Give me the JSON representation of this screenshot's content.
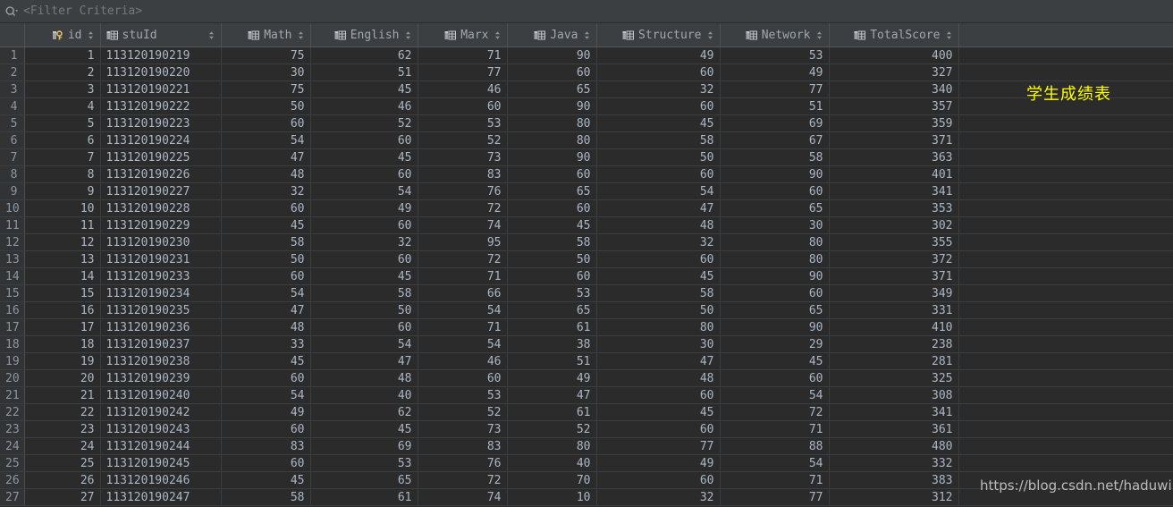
{
  "filter_bar": {
    "icon": "search-icon",
    "dropdown_icon": "chevron-down-icon",
    "placeholder": "<Filter Criteria>",
    "value": ""
  },
  "colors": {
    "background": "#2b2b2b",
    "header_background": "#3c3f41",
    "gutter_background": "#313335",
    "text": "#a9b7c6",
    "annotation": "#ffff00",
    "key_icon": "#e8bf6a"
  },
  "table": {
    "row_number_header": "",
    "columns": [
      {
        "label": "id",
        "icon": "primary-key-icon",
        "sortable": true,
        "align": "right"
      },
      {
        "label": "stuId",
        "icon": "column-icon",
        "sortable": true,
        "align": "left"
      },
      {
        "label": "Math",
        "icon": "column-icon",
        "sortable": true,
        "align": "right"
      },
      {
        "label": "English",
        "icon": "column-icon",
        "sortable": true,
        "align": "right"
      },
      {
        "label": "Marx",
        "icon": "column-icon",
        "sortable": true,
        "align": "right"
      },
      {
        "label": "Java",
        "icon": "column-icon",
        "sortable": true,
        "align": "right"
      },
      {
        "label": "Structure",
        "icon": "column-icon",
        "sortable": true,
        "align": "right"
      },
      {
        "label": "Network",
        "icon": "column-icon",
        "sortable": true,
        "align": "right"
      },
      {
        "label": "TotalScore",
        "icon": "column-icon",
        "sortable": true,
        "align": "right"
      }
    ],
    "rows": [
      {
        "n": "1",
        "id": "1",
        "stuId": "113120190219",
        "Math": "75",
        "English": "62",
        "Marx": "71",
        "Java": "90",
        "Structure": "49",
        "Network": "53",
        "TotalScore": "400"
      },
      {
        "n": "2",
        "id": "2",
        "stuId": "113120190220",
        "Math": "30",
        "English": "51",
        "Marx": "77",
        "Java": "60",
        "Structure": "60",
        "Network": "49",
        "TotalScore": "327"
      },
      {
        "n": "3",
        "id": "3",
        "stuId": "113120190221",
        "Math": "75",
        "English": "45",
        "Marx": "46",
        "Java": "65",
        "Structure": "32",
        "Network": "77",
        "TotalScore": "340"
      },
      {
        "n": "4",
        "id": "4",
        "stuId": "113120190222",
        "Math": "50",
        "English": "46",
        "Marx": "60",
        "Java": "90",
        "Structure": "60",
        "Network": "51",
        "TotalScore": "357"
      },
      {
        "n": "5",
        "id": "5",
        "stuId": "113120190223",
        "Math": "60",
        "English": "52",
        "Marx": "53",
        "Java": "80",
        "Structure": "45",
        "Network": "69",
        "TotalScore": "359"
      },
      {
        "n": "6",
        "id": "6",
        "stuId": "113120190224",
        "Math": "54",
        "English": "60",
        "Marx": "52",
        "Java": "80",
        "Structure": "58",
        "Network": "67",
        "TotalScore": "371"
      },
      {
        "n": "7",
        "id": "7",
        "stuId": "113120190225",
        "Math": "47",
        "English": "45",
        "Marx": "73",
        "Java": "90",
        "Structure": "50",
        "Network": "58",
        "TotalScore": "363"
      },
      {
        "n": "8",
        "id": "8",
        "stuId": "113120190226",
        "Math": "48",
        "English": "60",
        "Marx": "83",
        "Java": "60",
        "Structure": "60",
        "Network": "90",
        "TotalScore": "401"
      },
      {
        "n": "9",
        "id": "9",
        "stuId": "113120190227",
        "Math": "32",
        "English": "54",
        "Marx": "76",
        "Java": "65",
        "Structure": "54",
        "Network": "60",
        "TotalScore": "341"
      },
      {
        "n": "10",
        "id": "10",
        "stuId": "113120190228",
        "Math": "60",
        "English": "49",
        "Marx": "72",
        "Java": "60",
        "Structure": "47",
        "Network": "65",
        "TotalScore": "353"
      },
      {
        "n": "11",
        "id": "11",
        "stuId": "113120190229",
        "Math": "45",
        "English": "60",
        "Marx": "74",
        "Java": "45",
        "Structure": "48",
        "Network": "30",
        "TotalScore": "302"
      },
      {
        "n": "12",
        "id": "12",
        "stuId": "113120190230",
        "Math": "58",
        "English": "32",
        "Marx": "95",
        "Java": "58",
        "Structure": "32",
        "Network": "80",
        "TotalScore": "355"
      },
      {
        "n": "13",
        "id": "13",
        "stuId": "113120190231",
        "Math": "50",
        "English": "60",
        "Marx": "72",
        "Java": "50",
        "Structure": "60",
        "Network": "80",
        "TotalScore": "372"
      },
      {
        "n": "14",
        "id": "14",
        "stuId": "113120190233",
        "Math": "60",
        "English": "45",
        "Marx": "71",
        "Java": "60",
        "Structure": "45",
        "Network": "90",
        "TotalScore": "371"
      },
      {
        "n": "15",
        "id": "15",
        "stuId": "113120190234",
        "Math": "54",
        "English": "58",
        "Marx": "66",
        "Java": "53",
        "Structure": "58",
        "Network": "60",
        "TotalScore": "349"
      },
      {
        "n": "16",
        "id": "16",
        "stuId": "113120190235",
        "Math": "47",
        "English": "50",
        "Marx": "54",
        "Java": "65",
        "Structure": "50",
        "Network": "65",
        "TotalScore": "331"
      },
      {
        "n": "17",
        "id": "17",
        "stuId": "113120190236",
        "Math": "48",
        "English": "60",
        "Marx": "71",
        "Java": "61",
        "Structure": "80",
        "Network": "90",
        "TotalScore": "410"
      },
      {
        "n": "18",
        "id": "18",
        "stuId": "113120190237",
        "Math": "33",
        "English": "54",
        "Marx": "54",
        "Java": "38",
        "Structure": "30",
        "Network": "29",
        "TotalScore": "238"
      },
      {
        "n": "19",
        "id": "19",
        "stuId": "113120190238",
        "Math": "45",
        "English": "47",
        "Marx": "46",
        "Java": "51",
        "Structure": "47",
        "Network": "45",
        "TotalScore": "281"
      },
      {
        "n": "20",
        "id": "20",
        "stuId": "113120190239",
        "Math": "60",
        "English": "48",
        "Marx": "60",
        "Java": "49",
        "Structure": "48",
        "Network": "60",
        "TotalScore": "325"
      },
      {
        "n": "21",
        "id": "21",
        "stuId": "113120190240",
        "Math": "54",
        "English": "40",
        "Marx": "53",
        "Java": "47",
        "Structure": "60",
        "Network": "54",
        "TotalScore": "308"
      },
      {
        "n": "22",
        "id": "22",
        "stuId": "113120190242",
        "Math": "49",
        "English": "62",
        "Marx": "52",
        "Java": "61",
        "Structure": "45",
        "Network": "72",
        "TotalScore": "341"
      },
      {
        "n": "23",
        "id": "23",
        "stuId": "113120190243",
        "Math": "60",
        "English": "45",
        "Marx": "73",
        "Java": "52",
        "Structure": "60",
        "Network": "71",
        "TotalScore": "361"
      },
      {
        "n": "24",
        "id": "24",
        "stuId": "113120190244",
        "Math": "83",
        "English": "69",
        "Marx": "83",
        "Java": "80",
        "Structure": "77",
        "Network": "88",
        "TotalScore": "480"
      },
      {
        "n": "25",
        "id": "25",
        "stuId": "113120190245",
        "Math": "60",
        "English": "53",
        "Marx": "76",
        "Java": "40",
        "Structure": "49",
        "Network": "54",
        "TotalScore": "332"
      },
      {
        "n": "26",
        "id": "26",
        "stuId": "113120190246",
        "Math": "45",
        "English": "65",
        "Marx": "72",
        "Java": "70",
        "Structure": "60",
        "Network": "71",
        "TotalScore": "383"
      },
      {
        "n": "27",
        "id": "27",
        "stuId": "113120190247",
        "Math": "58",
        "English": "61",
        "Marx": "74",
        "Java": "10",
        "Structure": "32",
        "Network": "77",
        "TotalScore": "312"
      }
    ]
  },
  "overlays": {
    "annotation": "学生成绩表",
    "watermark": "https://blog.csdn.net/haduwi"
  }
}
